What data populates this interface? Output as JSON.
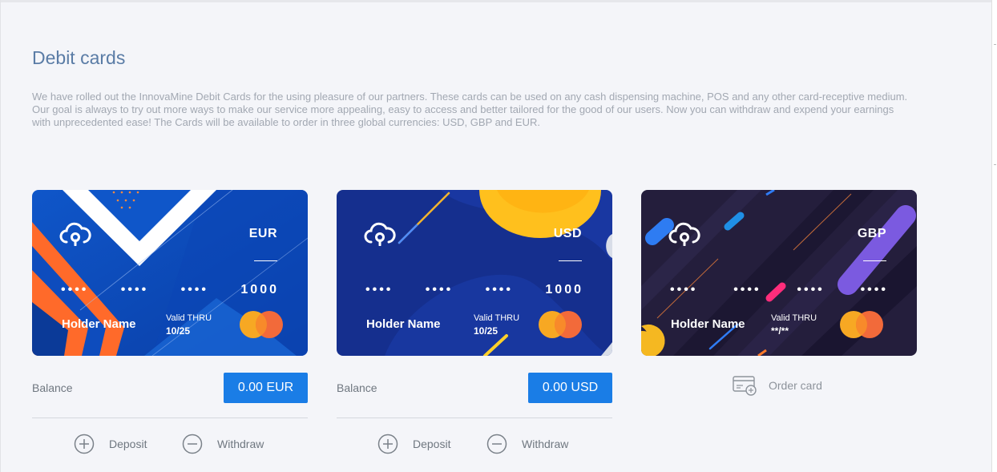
{
  "page": {
    "title": "Debit cards",
    "intro": "We have rolled out the InnovaMine Debit Cards for the using pleasure of our partners. These cards can be used on any cash dispensing machine, POS and any other card-receptive medium. Our goal is always to try out more ways to make our service more appealing, easy to access and better tailored for the good of our users. Now you can withdraw and expend your earnings with unprecedented ease! The Cards will be available to order in three global currencies: USD, GBP and EUR."
  },
  "cards": [
    {
      "currency": "EUR",
      "number_groups": [
        "••••",
        "••••",
        "••••",
        "1000"
      ],
      "holder": "Holder Name",
      "valid_label": "Valid THRU",
      "valid_date": "10/25",
      "balance_label": "Balance",
      "balance": "0.00 EUR",
      "deposit_label": "Deposit",
      "withdraw_label": "Withdraw"
    },
    {
      "currency": "USD",
      "number_groups": [
        "••••",
        "••••",
        "••••",
        "1000"
      ],
      "holder": "Holder Name",
      "valid_label": "Valid THRU",
      "valid_date": "10/25",
      "balance_label": "Balance",
      "balance": "0.00 USD",
      "deposit_label": "Deposit",
      "withdraw_label": "Withdraw"
    },
    {
      "currency": "GBP",
      "number_groups": [
        "••••",
        "••••",
        "••••",
        "••••"
      ],
      "holder": "Holder Name",
      "valid_label": "Valid THRU",
      "valid_date": "**/**",
      "order_label": "Order card"
    }
  ],
  "colors": {
    "accent": "#1a7de6",
    "title": "#5a7ca6",
    "eur_card": "#0e47b8",
    "usd_card": "#142f8c",
    "gbp_card": "#221d3a",
    "orange": "#ff6a2a",
    "mastercard_red": "#f26a3a",
    "mastercard_yellow": "#f7a823"
  },
  "icons": {
    "card_logo": "cloud-key-icon",
    "deposit": "plus-circle-icon",
    "withdraw": "minus-circle-icon",
    "order": "card-add-icon",
    "brand": "mastercard-icon"
  }
}
